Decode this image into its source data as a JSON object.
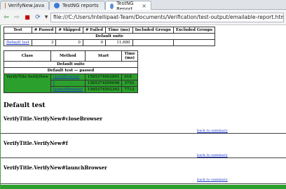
{
  "tabs": [
    {
      "label": "VerifyNew.java",
      "icon": "java-file-icon",
      "active": false
    },
    {
      "label": "TestNG reports",
      "icon": "testng-icon",
      "active": false
    },
    {
      "label": "TestNG Report",
      "icon": "globe-icon",
      "active": true
    }
  ],
  "toolbar": {
    "url": "file:///C:/Users/Intellipaat-Team/Documents/Verification/test-output/emailable-report.html#m1"
  },
  "summary": {
    "headers": [
      "Test",
      "# Passed",
      "# Skipped",
      "# Failed",
      "Time (ms)",
      "Included Groups",
      "Excluded Groups"
    ],
    "suite_label": "Default suite",
    "row": {
      "test": "Default test",
      "passed": "3",
      "skipped": "0",
      "failed": "0",
      "time": "11,680",
      "included": "",
      "excluded": ""
    }
  },
  "detail": {
    "headers": [
      "Class",
      "Method",
      "Start",
      "Time (ms)"
    ],
    "suite_label": "Default suite",
    "test_label": "Default test — passed",
    "class_name": "VerifyTitle.VerifyNew",
    "rows": [
      {
        "method": "closeBrowser",
        "start": "1565374602891",
        "time": "618"
      },
      {
        "method": "f",
        "start": "1565374599098",
        "time": "3793"
      },
      {
        "method": "launchBrowser",
        "start": "1565374592342",
        "time": "7713"
      }
    ]
  },
  "main": {
    "title": "Default test",
    "methods": [
      "VerifyTitle.VerifyNew#closeBrowser",
      "VerifyTitle.VerifyNew#f",
      "VerifyTitle.VerifyNew#launchBrowser"
    ],
    "back_label": "back to summary"
  },
  "colors": {
    "pass": "#2ca02c",
    "link": "#1a35c8"
  }
}
